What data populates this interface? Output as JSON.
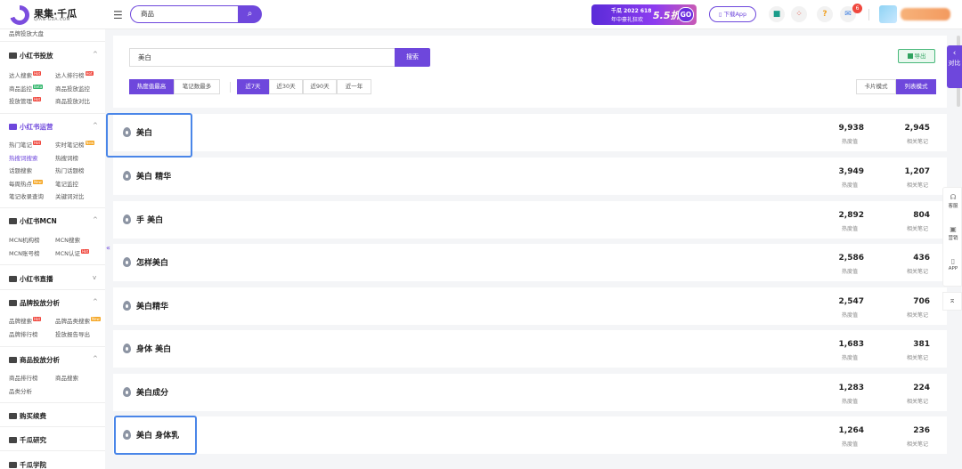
{
  "header": {
    "logo_text": "果集·千瓜",
    "logo_sub": "QIAN-GUA.COM",
    "search_value": "商品",
    "promo_line1": "千瓜 2022 618",
    "promo_line2": "年中豪礼狂欢",
    "promo_big": "5.5折",
    "promo_go": "GO",
    "download_label": "下载App",
    "notif_count": "6"
  },
  "sidebar": {
    "top_item": "品牌投放大盘",
    "sections": [
      {
        "title": "小红书投放",
        "items": [
          "达人搜索",
          "达人排行榜",
          "商品监控",
          "商品投放监控",
          "投放管理",
          "商品投放对比"
        ]
      },
      {
        "title": "小红书运营",
        "items": [
          "热门笔记",
          "实时笔记榜",
          "热搜词搜索",
          "热搜词榜",
          "话题搜索",
          "热门话题榜",
          "每周热点",
          "笔记监控",
          "笔记收录查询",
          "关键词对比"
        ]
      },
      {
        "title": "小红书MCN",
        "items": [
          "MCN机构榜",
          "MCN搜索",
          "MCN账号榜",
          "MCN认证"
        ]
      },
      {
        "title": "小红书直播"
      },
      {
        "title": "品牌投放分析",
        "items": [
          "品牌搜索",
          "品牌品类搜索",
          "品牌排行榜",
          "投放报告导出"
        ]
      },
      {
        "title": "商品投放分析",
        "items": [
          "商品排行榜",
          "商品搜索",
          "品类分析"
        ]
      },
      {
        "title": "购买续费"
      },
      {
        "title": "千瓜研究"
      },
      {
        "title": "千瓜学院"
      }
    ],
    "tags": {
      "hot": "Hot",
      "new": "New",
      "beta": "Beta"
    }
  },
  "search": {
    "keyword": "美白",
    "button": "搜索",
    "export": "导出"
  },
  "filters": {
    "sort": [
      "热度值最高",
      "笔记数最多"
    ],
    "range": [
      "近7天",
      "近30天",
      "近90天",
      "近一年"
    ],
    "view": [
      "卡片模式",
      "列表模式"
    ]
  },
  "labels": {
    "heat": "热度值",
    "notes": "相关笔记"
  },
  "rows": [
    {
      "kw": "美白",
      "heat": "9,938",
      "notes": "2,945"
    },
    {
      "kw": "美白 精华",
      "heat": "3,949",
      "notes": "1,207"
    },
    {
      "kw": "手 美白",
      "heat": "2,892",
      "notes": "804"
    },
    {
      "kw": "怎样美白",
      "heat": "2,586",
      "notes": "436"
    },
    {
      "kw": "美白精华",
      "heat": "2,547",
      "notes": "706"
    },
    {
      "kw": "身体 美白",
      "heat": "1,683",
      "notes": "381"
    },
    {
      "kw": "美白成分",
      "heat": "1,283",
      "notes": "224"
    },
    {
      "kw": "美白 身体乳",
      "heat": "1,264",
      "notes": "236"
    }
  ],
  "float": {
    "compare": "对比",
    "service": "客服",
    "marketing": "营销",
    "app": "APP"
  }
}
